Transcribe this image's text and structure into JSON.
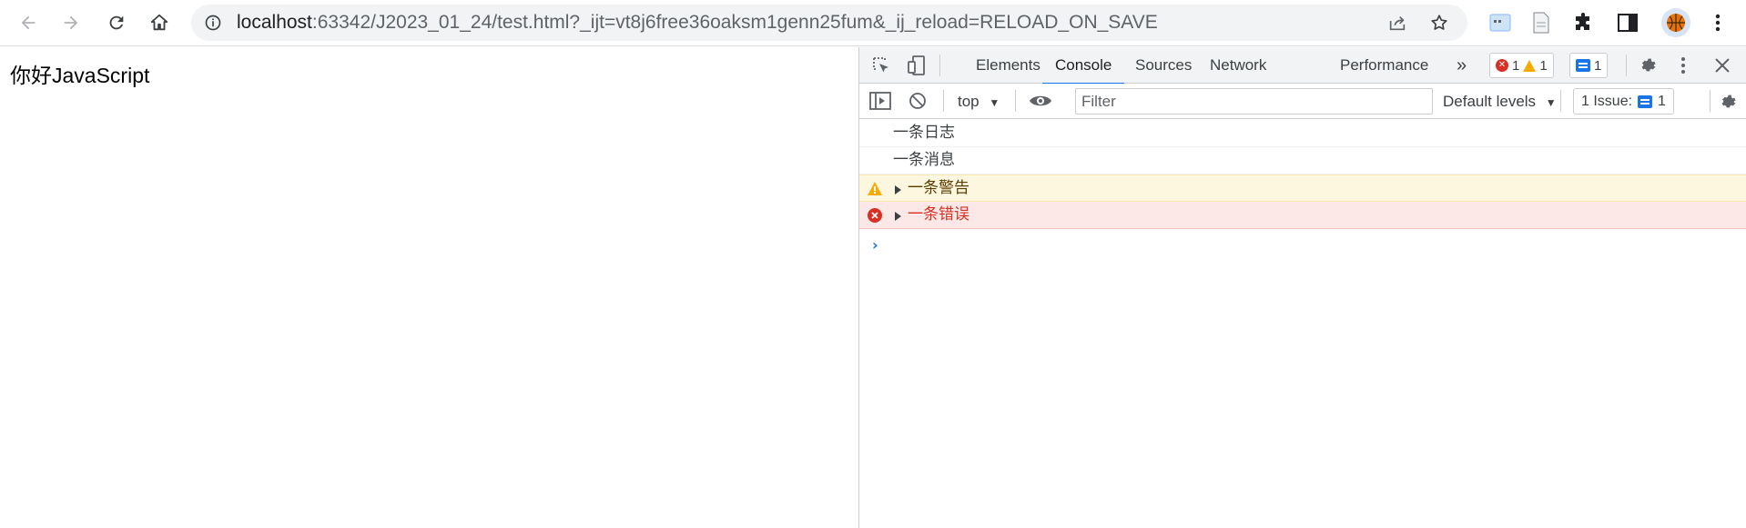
{
  "browser": {
    "url_host": "localhost",
    "url_rest": ":63342/J2023_01_24/test.html?_ijt=vt8j6free36oaksm1genn25fum&_ij_reload=RELOAD_ON_SAVE",
    "icons": [
      "back-arrow-icon",
      "forward-arrow-icon",
      "reload-icon",
      "home-icon",
      "site-info-icon",
      "share-icon",
      "bookmark-star-icon",
      "extension-window-icon",
      "extension-doc-icon",
      "extensions-puzzle-icon",
      "side-panel-icon",
      "profile-avatar-icon",
      "more-vertical-icon"
    ]
  },
  "page": {
    "text": "你好JavaScript"
  },
  "devtools": {
    "tabs": [
      "Elements",
      "Console",
      "Sources",
      "Network",
      "Performance"
    ],
    "active_tab": "Console",
    "more_tabs": "»",
    "counters": {
      "errors": "1",
      "warnings": "1",
      "messages": "1"
    },
    "toolbar": {
      "context": "top",
      "filter_placeholder": "Filter",
      "levels": "Default levels",
      "issues_label": "1 Issue:",
      "issues_count": "1"
    },
    "console": [
      {
        "level": "log",
        "text": "一条日志"
      },
      {
        "level": "info",
        "text": "一条消息"
      },
      {
        "level": "warn",
        "text": "一条警告"
      },
      {
        "level": "error",
        "text": "一条错误"
      }
    ],
    "prompt": "›"
  },
  "colors": {
    "accent": "#1a73e8",
    "error": "#d93025",
    "warning": "#f9ab00",
    "warning_bg": "#fef7e0",
    "error_bg": "#fce8e6"
  }
}
